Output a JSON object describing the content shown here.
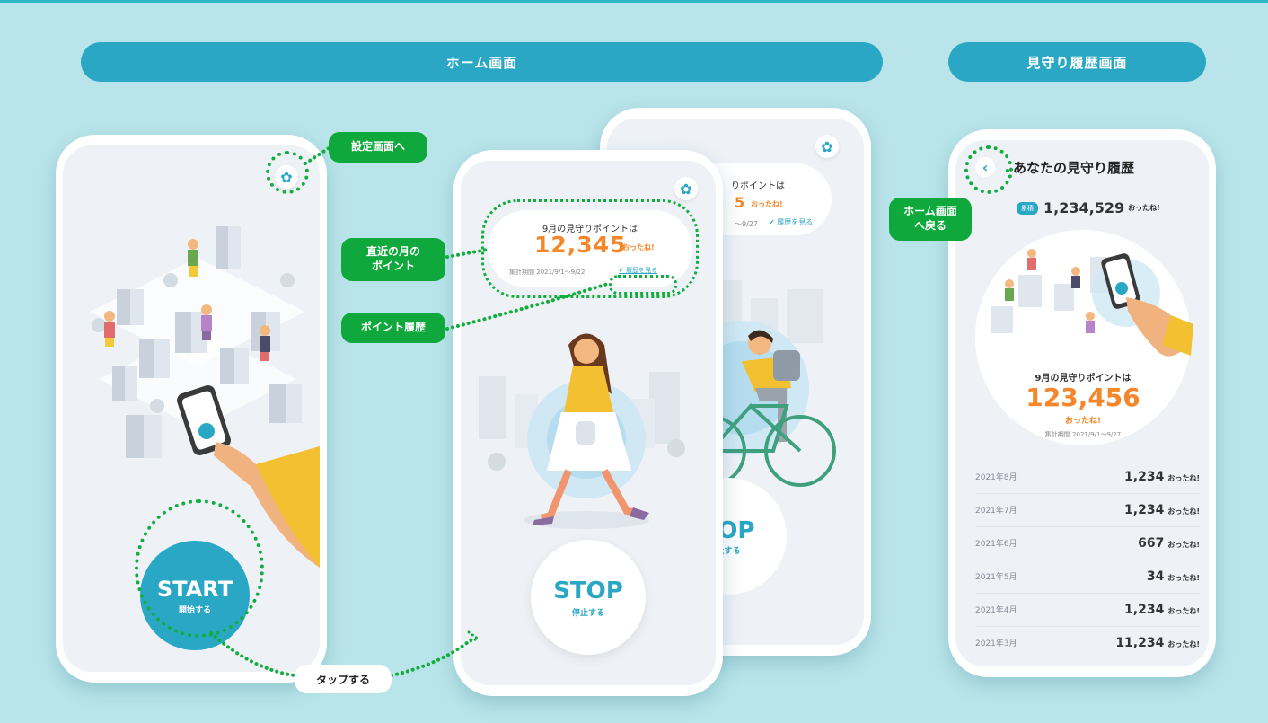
{
  "banners": {
    "home": "ホーム画面",
    "history": "見守り履歴画面"
  },
  "annotations": {
    "to_settings": "設定画面へ",
    "recent_month_line1": "直近の月の",
    "recent_month_line2": "ポイント",
    "point_history": "ポイント履歴",
    "tap": "タップする",
    "back_line1": "ホーム画面",
    "back_line2": "へ戻る"
  },
  "home_screen": {
    "start_label": "START",
    "start_sub": "開始する"
  },
  "stop_screen": {
    "point_title": "9月の見守りポイントは",
    "point_value": "12,345",
    "point_unit": "おったね!",
    "period_label": "集計期間",
    "period_value": "2021/9/1〜9/22",
    "history_link": "履歴を見る",
    "stop_label": "STOP",
    "stop_sub": "停止する"
  },
  "bike_screen": {
    "point_title": "りポイントは",
    "point_partial": "5",
    "point_unit": "おったね!",
    "period_value": "〜9/27",
    "history_link": "履歴を見る",
    "stop_label": "TOP",
    "stop_sub": "止する"
  },
  "history_screen": {
    "title": "あなたの見守り履歴",
    "total_badge": "累積",
    "total_value": "1,234,529",
    "total_unit": "おったね!",
    "month_title": "9月の見守りポイントは",
    "month_value": "123,456",
    "month_unit": "おったね!",
    "period_label": "集計期間",
    "period_value": "2021/9/1〜9/27",
    "rows": [
      {
        "month": "2021年8月",
        "value": "1,234",
        "unit": "おったね!"
      },
      {
        "month": "2021年7月",
        "value": "1,234",
        "unit": "おったね!"
      },
      {
        "month": "2021年6月",
        "value": "667",
        "unit": "おったね!"
      },
      {
        "month": "2021年5月",
        "value": "34",
        "unit": "おったね!"
      },
      {
        "month": "2021年4月",
        "value": "1,234",
        "unit": "おったね!"
      },
      {
        "month": "2021年3月",
        "value": "11,234",
        "unit": "おったね!"
      }
    ]
  },
  "colors": {
    "background": "#b9e5ea",
    "accent": "#2aa7c4",
    "annotation_green": "#0fa83c",
    "points_orange": "#f5872a"
  },
  "icons": [
    "gear-icon",
    "check-circle-icon",
    "back-chevron-icon"
  ]
}
